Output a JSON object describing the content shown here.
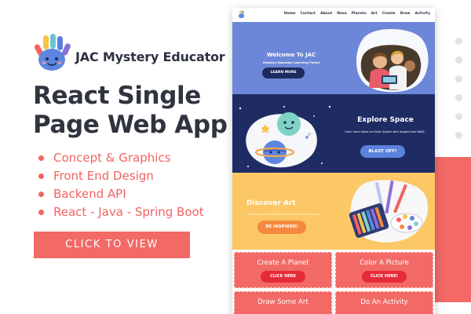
{
  "brand": {
    "name": "JAC Mystery Educator",
    "logo_icon": "hand-logo-icon"
  },
  "headline": {
    "line1": "React Single",
    "line2": "Page Web App"
  },
  "features": [
    {
      "label": "Concept & Graphics"
    },
    {
      "label": "Front End Design"
    },
    {
      "label": "Backend API"
    },
    {
      "label": "React - Java - Spring Boot"
    }
  ],
  "cta": {
    "label": "CLICK TO VIEW"
  },
  "colors": {
    "accent": "#f26966",
    "headline": "#30343f",
    "welcome_bg": "#6c86d8",
    "space_bg": "#1f2c63",
    "art_bg": "#fbc865",
    "tile_bg": "#f26966",
    "tile_button": "#e62b38"
  },
  "mockup": {
    "nav": {
      "links": [
        {
          "label": "Home"
        },
        {
          "label": "Contact"
        },
        {
          "label": "About"
        },
        {
          "label": "Nasa"
        },
        {
          "label": "Planets"
        },
        {
          "label": "Art"
        },
        {
          "label": "Create"
        },
        {
          "label": "Draw"
        },
        {
          "label": "Activity"
        }
      ]
    },
    "welcome": {
      "title": "Welcome To JAC",
      "subtitle": "Mystery Educator Learning Portal",
      "button": "LEARN MORE",
      "image_icon": "students-photo-icon"
    },
    "space": {
      "title": "Explore Space",
      "subtitle": "Learn more about our Solar System with images from NASA",
      "button": "BLAST OFF!",
      "image_icon": "planets-icon"
    },
    "art": {
      "title": "Discover Art",
      "subtitle": "Learn about art and artists with information from museums",
      "button": "BE INSPIRED!",
      "image_icon": "art-supplies-icon"
    },
    "tiles": [
      {
        "title": "Create A Planet",
        "button": "CLICK HERE"
      },
      {
        "title": "Color A Picture",
        "button": "CLICK HERE!"
      },
      {
        "title": "Draw Some Art",
        "button": ""
      },
      {
        "title": "Do An Activity",
        "button": ""
      }
    ]
  }
}
